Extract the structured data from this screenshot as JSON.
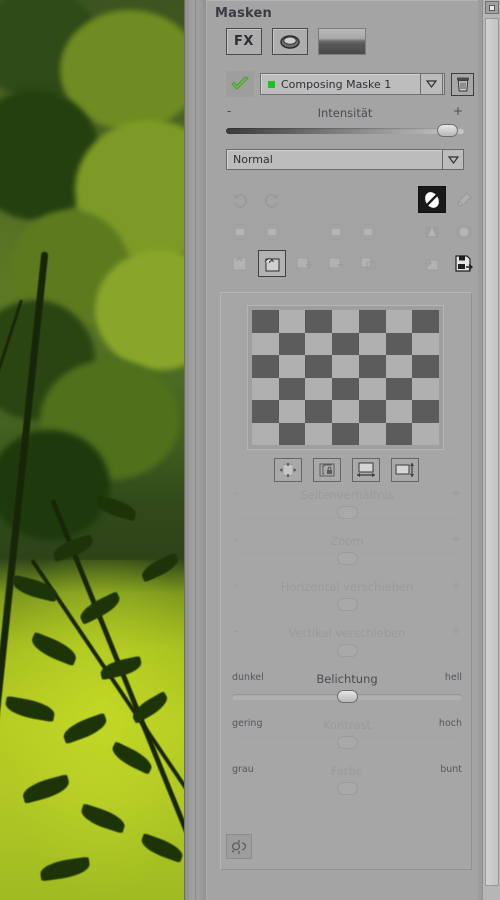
{
  "panel": {
    "title": "Masken",
    "mode_buttons": [
      {
        "label": "FX",
        "name": "fx-button"
      },
      {
        "label": "",
        "name": "lens-filter-button"
      },
      {
        "label": "",
        "name": "image-thumbnail-button"
      }
    ],
    "mask_row": {
      "enabled_checkmark": "checkmark-icon",
      "color_swatch": "#18c51c",
      "mask_name": "Composing Maske 1",
      "dropdown_icon": "chevron-down-icon",
      "delete_icon": "trash-icon"
    },
    "intensity": {
      "label": "Intensität",
      "minus": "-",
      "plus": "+",
      "knob_percent": 96
    },
    "blend_mode": {
      "value": "Normal",
      "dropdown_icon": "chevron-down-icon"
    },
    "tool_rows": {
      "row1": [
        {
          "name": "undo-icon",
          "state": "disabled"
        },
        {
          "name": "redo-icon",
          "state": "disabled"
        },
        {
          "name": "invert-mask-icon",
          "state": "selected"
        },
        {
          "name": "brush-icon",
          "state": "disabled"
        }
      ],
      "row2": [
        {
          "name": "mask-box-1-icon",
          "state": "disabled"
        },
        {
          "name": "mask-box-2-icon",
          "state": "disabled"
        },
        {
          "name": "mask-box-3-icon",
          "state": "disabled"
        },
        {
          "name": "mask-box-4-icon",
          "state": "disabled"
        },
        {
          "name": "gradient-linear-icon",
          "state": "disabled"
        },
        {
          "name": "gradient-radial-icon",
          "state": "disabled"
        }
      ],
      "row3": [
        {
          "name": "layer-new-icon",
          "state": "disabled"
        },
        {
          "name": "layer-select-icon",
          "state": "enabled"
        },
        {
          "name": "layer-add-icon",
          "state": "disabled"
        },
        {
          "name": "layer-subtract-icon",
          "state": "disabled"
        },
        {
          "name": "layer-intersect-icon",
          "state": "disabled"
        },
        {
          "name": "layer-import-icon",
          "state": "disabled"
        },
        {
          "name": "save-export-icon",
          "state": "enabled"
        }
      ]
    },
    "preview": {
      "checkerboard": {
        "columns": 7,
        "rows": 6,
        "dark": "#5c5c5c",
        "light": "#b0b0b0"
      },
      "ratio_buttons": [
        {
          "name": "fit-expand-button"
        },
        {
          "name": "lock-aspect-ratio-button"
        },
        {
          "name": "width-button"
        },
        {
          "name": "height-button"
        }
      ],
      "sliders": [
        {
          "label": "Seitenverhältnis",
          "left": "-",
          "right": "+",
          "knob_percent": 50,
          "disabled": true,
          "name": "aspect-ratio-slider"
        },
        {
          "label": "Zoom",
          "left": "-",
          "right": "+",
          "knob_percent": 50,
          "disabled": true,
          "name": "zoom-slider"
        },
        {
          "label": "Horizontal verschieben",
          "left": "-",
          "right": "+",
          "knob_percent": 50,
          "disabled": true,
          "name": "horizontal-shift-slider"
        },
        {
          "label": "Vertikal verschieben",
          "left": "-",
          "right": "+",
          "knob_percent": 50,
          "disabled": true,
          "name": "vertical-shift-slider"
        },
        {
          "label": "Belichtung",
          "left": "dunkel",
          "right": "hell",
          "knob_percent": 50,
          "disabled": false,
          "name": "exposure-slider"
        },
        {
          "label": "Kontrast",
          "left": "gering",
          "right": "hoch",
          "knob_percent": 50,
          "disabled": true,
          "name": "contrast-slider"
        },
        {
          "label": "Farbe",
          "left": "grau",
          "right": "bunt",
          "knob_percent": 50,
          "disabled": true,
          "name": "color-slider"
        }
      ],
      "reset_icon": "reset-refresh-icon"
    }
  },
  "scrollbar": {
    "up_icon": "scroll-up-button",
    "thumb": "scrollbar-thumb"
  }
}
